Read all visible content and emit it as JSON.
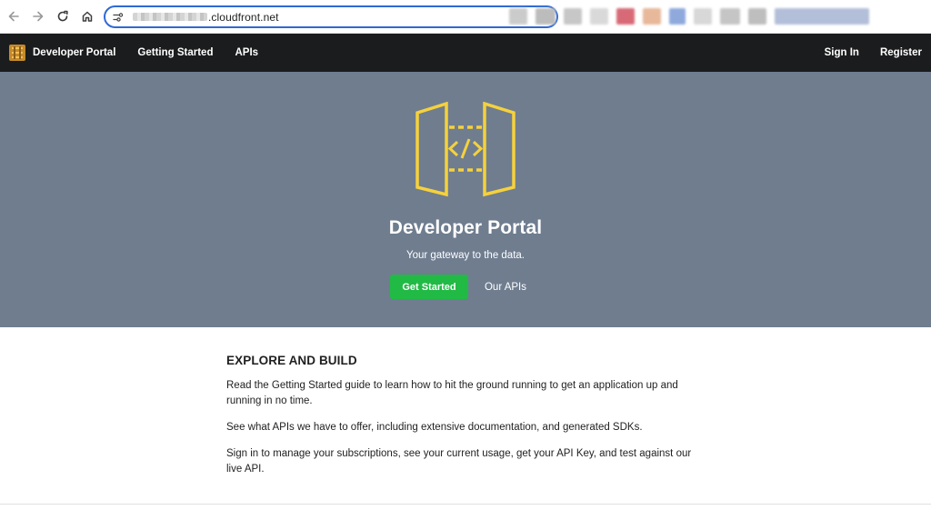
{
  "browser": {
    "url_suffix": ".cloudfront.net",
    "icons": [
      "back-arrow-icon",
      "forward-arrow-icon",
      "reload-icon",
      "home-icon",
      "site-settings-icon"
    ]
  },
  "navbar": {
    "brand": "Developer Portal",
    "links": {
      "getting_started": "Getting Started",
      "apis": "APIs"
    },
    "sign_in": "Sign In",
    "register": "Register"
  },
  "hero": {
    "title": "Developer Portal",
    "subtitle": "Your gateway to the data.",
    "get_started_label": "Get Started",
    "our_apis_label": "Our APIs",
    "background_color": "#6f7d8f",
    "icon_color": "#f5d13c",
    "button_color": "#21ba45"
  },
  "content": {
    "heading": "EXPLORE AND BUILD",
    "paragraphs": [
      "Read the Getting Started guide to learn how to hit the ground running to get an application up and running in no time.",
      "See what APIs we have to offer, including extensive documentation, and generated SDKs.",
      "Sign in to manage your subscriptions, see your current usage, get your API Key, and test against our live API."
    ]
  }
}
